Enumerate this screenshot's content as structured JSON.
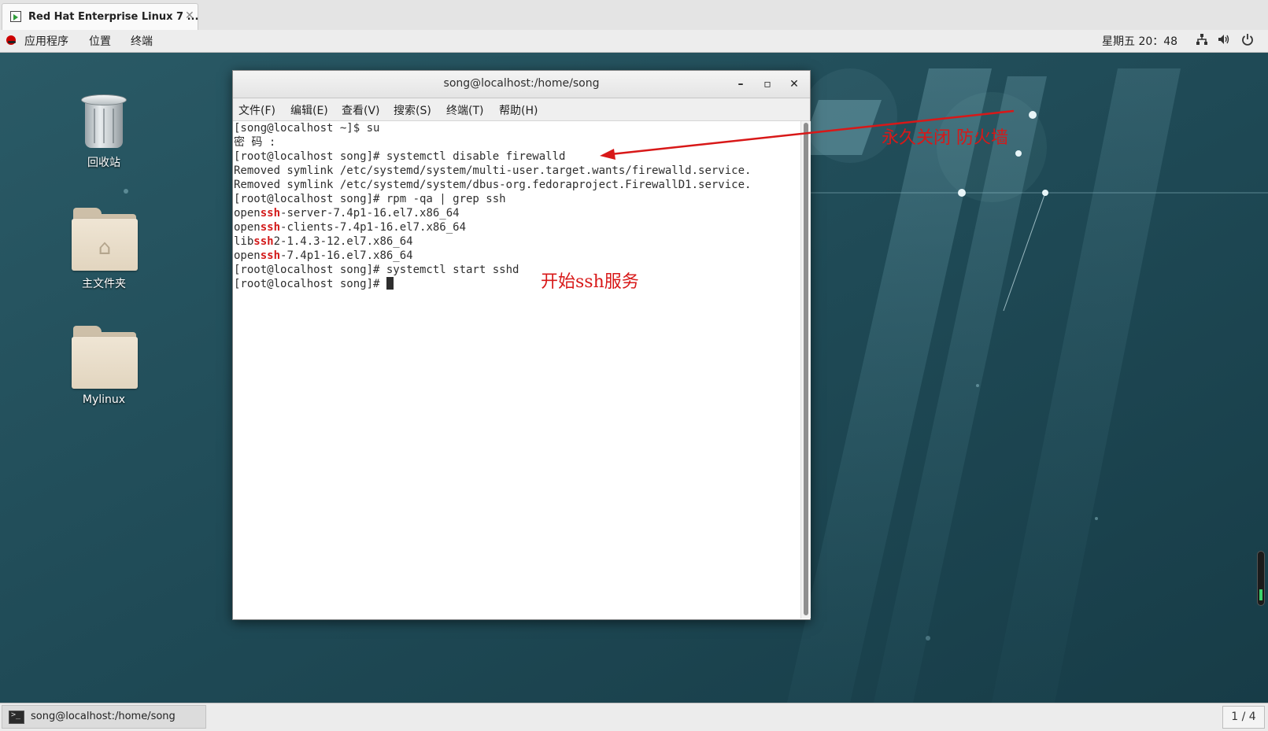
{
  "vm_tab": {
    "title": "Red Hat Enterprise Linux 7 ...",
    "close": "✕"
  },
  "topbar": {
    "apps": "应用程序",
    "places": "位置",
    "terminal": "终端",
    "clock": "星期五 20：48",
    "icons": [
      "network-icon",
      "volume-icon",
      "power-icon"
    ]
  },
  "desktop": {
    "icons": [
      {
        "label": "回收站",
        "kind": "trash"
      },
      {
        "label": "主文件夹",
        "kind": "home-folder"
      },
      {
        "label": "Mylinux",
        "kind": "folder"
      }
    ]
  },
  "terminal": {
    "title": "song@localhost:/home/song",
    "controls": {
      "minimize": "–",
      "maximize": "▫",
      "close": "✕"
    },
    "menu": [
      "文件(F)",
      "编辑(E)",
      "查看(V)",
      "搜索(S)",
      "终端(T)",
      "帮助(H)"
    ],
    "lines": [
      "[song@localhost ~]$ su",
      "密 码 :",
      "[root@localhost song]# systemctl disable firewalld",
      "Removed symlink /etc/systemd/system/multi-user.target.wants/firewalld.service.",
      "Removed symlink /etc/systemd/system/dbus-org.fedoraproject.FirewallD1.service.",
      "[root@localhost song]# rpm -qa | grep ssh"
    ],
    "grep_results": [
      {
        "pre": "open",
        "match": "ssh",
        "post": "-server-7.4p1-16.el7.x86_64"
      },
      {
        "pre": "open",
        "match": "ssh",
        "post": "-clients-7.4p1-16.el7.x86_64"
      },
      {
        "pre": "lib",
        "match": "ssh",
        "post": "2-1.4.3-12.el7.x86_64"
      },
      {
        "pre": "open",
        "match": "ssh",
        "post": "-7.4p1-16.el7.x86_64"
      }
    ],
    "after_lines": [
      "[root@localhost song]# systemctl start sshd",
      "[root@localhost song]# "
    ]
  },
  "annotations": {
    "firewall": "永久关闭  防火墙",
    "ssh": "开始ssh服务"
  },
  "taskbar": {
    "window_label": "song@localhost:/home/song",
    "workspace": "1 / 4"
  },
  "colors": {
    "desktop_bg": "#1f4b57",
    "annotation_red": "#d81818",
    "grep_highlight": "#d31a1a"
  }
}
